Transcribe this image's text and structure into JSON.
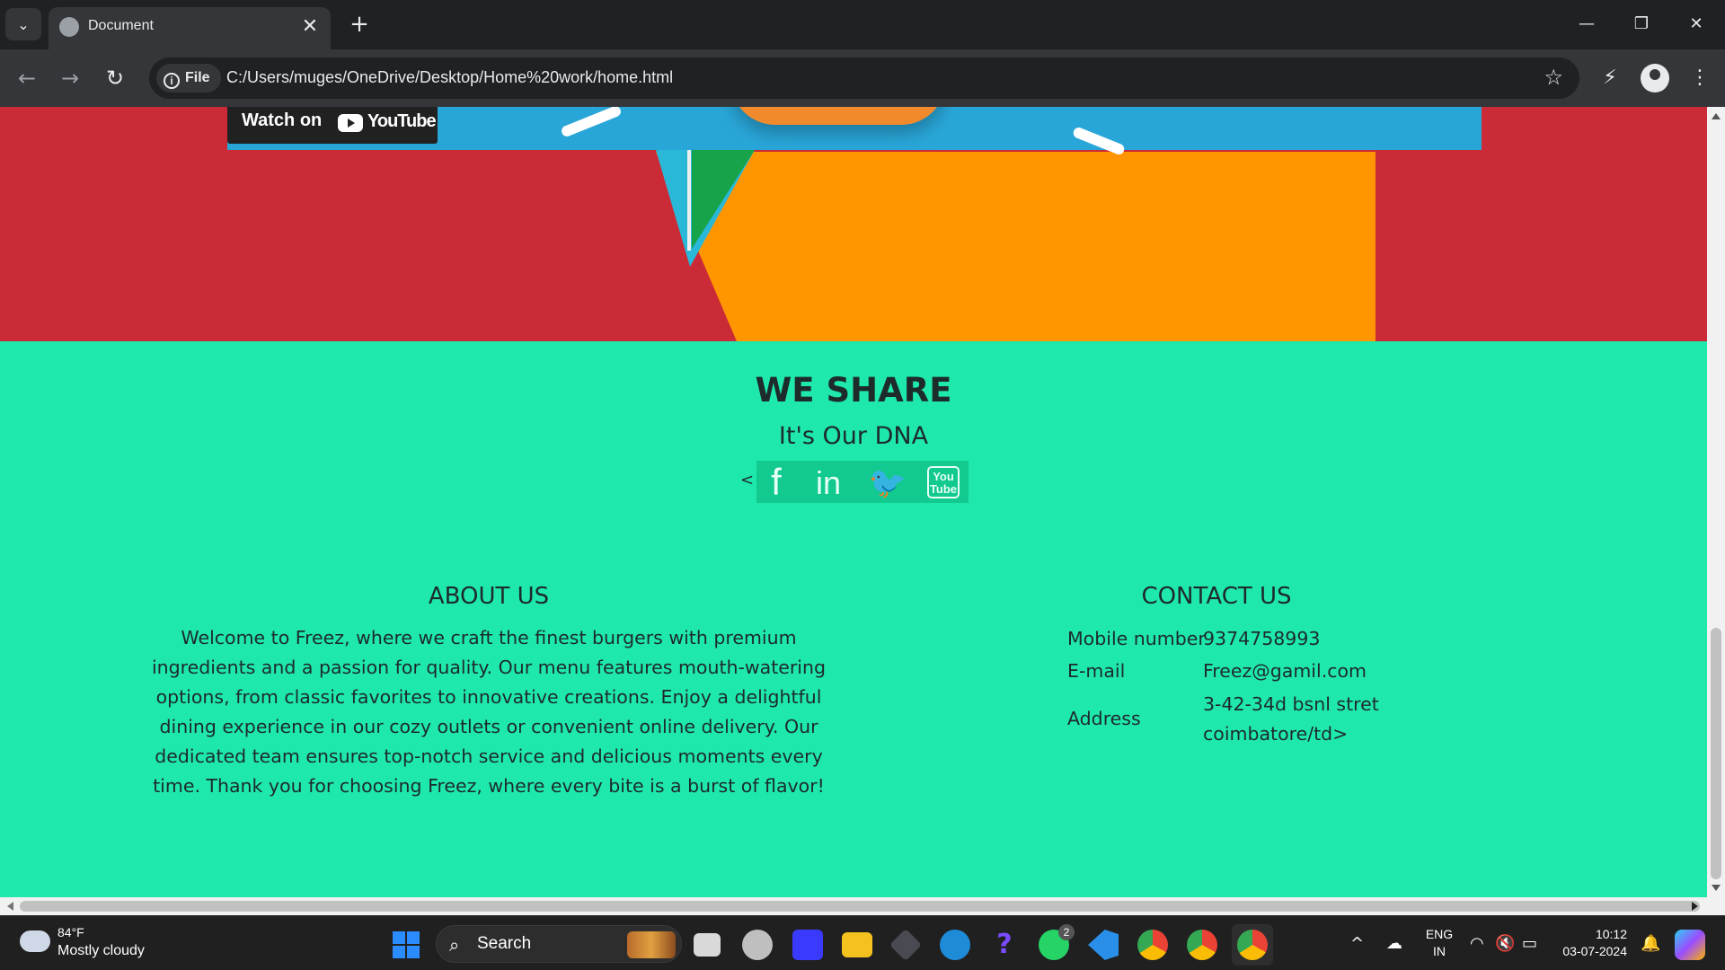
{
  "browser": {
    "tab_title": "Document",
    "new_tab_label": "+",
    "close_tab_label": "✕",
    "tab_list_label": "⌄",
    "site_chip": "File",
    "site_chip_icon": "i",
    "url": "C:/Users/muges/OneDrive/Desktop/Home%20work/home.html",
    "window_controls": {
      "minimize": "—",
      "restore": "❐",
      "close": "✕"
    },
    "nav": {
      "back": "←",
      "forward": "→",
      "reload": "↻"
    },
    "bookmark_icon": "☆"
  },
  "video": {
    "watch_on": "Watch on",
    "youtube": "YouTube"
  },
  "share": {
    "title": "WE SHARE",
    "subtitle": "It's Our DNA",
    "stray_text": "<",
    "icons": {
      "facebook": "f",
      "linkedin": "in",
      "twitter": "🐦",
      "youtube_line1": "You",
      "youtube_line2": "Tube"
    }
  },
  "about": {
    "title": "ABOUT US",
    "text": "Welcome to Freez, where we craft the finest burgers with premium ingredients and a passion for quality. Our menu features mouth-watering options, from classic favorites to innovative creations. Enjoy a delightful dining experience in our cozy outlets or convenient online delivery. Our dedicated team ensures top-notch service and delicious moments every time. Thank you for choosing Freez, where every bite is a burst of flavor!"
  },
  "contact": {
    "title": "CONTACT US",
    "rows": [
      {
        "label": "Mobile number",
        "value": "9374758993"
      },
      {
        "label": "E-mail",
        "value": "Freez@gamil.com"
      },
      {
        "label": "Address",
        "value": "3-42-34d bsnl stret coimbatore/td>"
      }
    ]
  },
  "taskbar": {
    "weather_temp": "84°F",
    "weather_desc": "Mostly cloudy",
    "search_placeholder": "Search",
    "search_icon": "⌕",
    "language_line1": "ENG",
    "language_line2": "IN",
    "time": "10:12",
    "date": "03-07-2024",
    "whatsapp_badge": "2",
    "tray_chevron": "^"
  },
  "colors": {
    "page_bg": "#1fe8ad",
    "hero_red": "#cb2b36",
    "hero_orange": "#ff9600",
    "social_bg": "#12c98f"
  }
}
